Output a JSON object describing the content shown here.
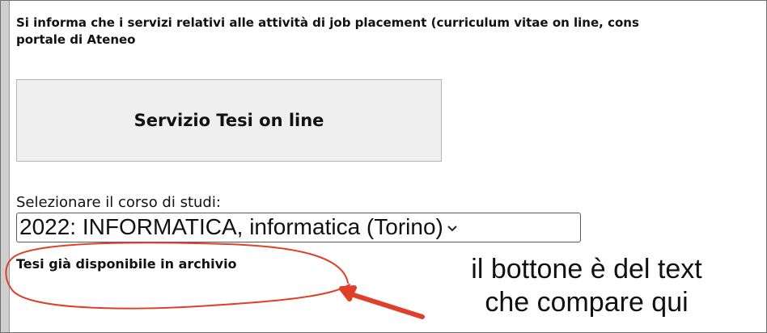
{
  "page": {
    "notice_line1": "Si informa che i servizi relativi alle attività di job placement (curriculum vitae on line, cons",
    "notice_line2": "portale di Ateneo"
  },
  "tesi_button": {
    "label": "Servizio Tesi on line"
  },
  "course": {
    "label": "Selezionare il corso di studi:",
    "selected": "2022: INFORMATICA, informatica (Torino)"
  },
  "archive": {
    "label": "Tesi già disponibile in archivio"
  },
  "annotation": {
    "note_line1": "il bottone è del text",
    "note_line2": "che compare qui",
    "ink_color": "#e0402a"
  }
}
